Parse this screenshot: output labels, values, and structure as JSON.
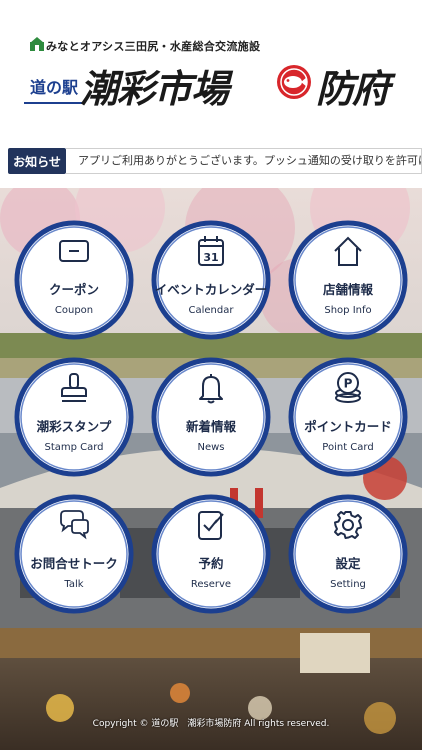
{
  "header": {
    "subtitle": "みなとオアシス三田尻・水産総合交流施設",
    "michi_label": "道の駅",
    "brand_main": "潮彩市場",
    "brand_city": "防府"
  },
  "notice": {
    "label": "お知らせ",
    "text": "アプリご利用ありがとうございます。プッシュ通知の受け取りを許可にす"
  },
  "menu": [
    {
      "jp": "クーポン",
      "en": "Coupon",
      "icon": "coupon-icon"
    },
    {
      "jp": "イベントカレンダー",
      "en": "Calendar",
      "icon": "calendar-icon",
      "calendar_day": "31"
    },
    {
      "jp": "店舗情報",
      "en": "Shop Info",
      "icon": "home-icon"
    },
    {
      "jp": "潮彩スタンプ",
      "en": "Stamp Card",
      "icon": "stamp-icon"
    },
    {
      "jp": "新着情報",
      "en": "News",
      "icon": "bell-icon"
    },
    {
      "jp": "ポイントカード",
      "en": "Point Card",
      "icon": "point-card-icon",
      "point_letter": "P"
    },
    {
      "jp": "お問合せトーク",
      "en": "Talk",
      "icon": "chat-icon"
    },
    {
      "jp": "予約",
      "en": "Reserve",
      "icon": "reserve-icon"
    },
    {
      "jp": "設定",
      "en": "Setting",
      "icon": "gear-icon"
    }
  ],
  "footer": {
    "copyright": "Copyright © 道の駅　潮彩市場防府 All rights reserved."
  },
  "colors": {
    "navy": "#22345c",
    "ring_blue": "#1c3f8f",
    "text_navy": "#1e2c4a"
  }
}
